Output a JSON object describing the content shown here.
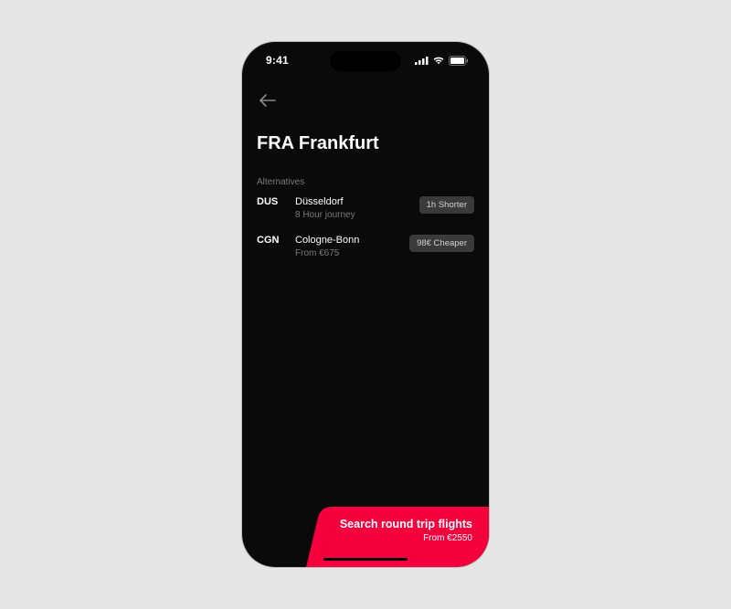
{
  "status": {
    "time": "9:41"
  },
  "nav": {
    "back_label": "Back"
  },
  "header": {
    "title": "FRA Frankfurt"
  },
  "alternatives": {
    "label": "Alternatives",
    "items": [
      {
        "code": "DUS",
        "name": "Düsseldorf",
        "subline": "8 Hour journey",
        "badge": "1h Shorter"
      },
      {
        "code": "CGN",
        "name": "Cologne-Bonn",
        "subline": "From €675",
        "badge": "98€ Cheaper"
      }
    ]
  },
  "cta": {
    "title": "Search round trip flights",
    "subline": "From €2550",
    "accent": "#f4003d"
  }
}
